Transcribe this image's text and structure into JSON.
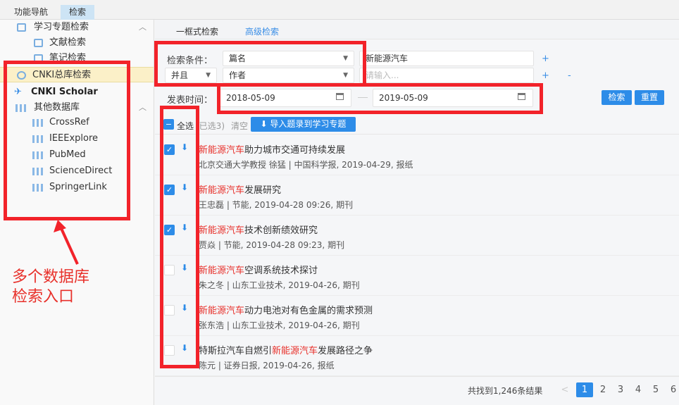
{
  "top_tabs": [
    "功能导航",
    "检索"
  ],
  "sidebar": {
    "topic_search": "学习专题检索",
    "doc_search": "文献检索",
    "note_search": "笔记检索",
    "cnki_total": "CNKI总库检索",
    "cnki_scholar": "CNKI Scholar",
    "other_db": "其他数据库",
    "databases": [
      "CrossRef",
      "IEEExplore",
      "PubMed",
      "ScienceDirect",
      "SpringerLink"
    ]
  },
  "search_tabs": [
    "一框式检索",
    "高级检索"
  ],
  "form": {
    "cond_label": "检索条件：",
    "field1": "篇名",
    "value1": "新能源汽车",
    "logic": "并且",
    "field2": "作者",
    "placeholder2": "请输入...",
    "date_label": "发表时间：",
    "date_from": "2018-05-09",
    "date_to": "2019-05-09",
    "search_btn": "检索",
    "reset_btn": "重置",
    "plus": "+",
    "minus": "-"
  },
  "toolbar": {
    "select_all": "全选",
    "selected": "(已选3)",
    "clear": "清空",
    "import_btn": "导入题录到学习专题"
  },
  "results": [
    {
      "pre": "",
      "hl": "新能源汽车",
      "post": "助力城市交通可持续发展",
      "meta": "北京交通大学教授 徐猛 | 中国科学报, 2019-04-29, 报纸",
      "checked": true
    },
    {
      "pre": "",
      "hl": "新能源汽车",
      "post": "发展研究",
      "meta": "王忠磊 | 节能, 2019-04-28 09:26, 期刊",
      "checked": true
    },
    {
      "pre": "",
      "hl": "新能源汽车",
      "post": "技术创新绩效研究",
      "meta": "贾焱 | 节能, 2019-04-28 09:23, 期刊",
      "checked": true
    },
    {
      "pre": "",
      "hl": "新能源汽车",
      "post": "空调系统技术探讨",
      "meta": "朱之冬 | 山东工业技术, 2019-04-26, 期刊",
      "checked": false
    },
    {
      "pre": "",
      "hl": "新能源汽车",
      "post": "动力电池对有色金属的需求预测",
      "meta": "张东浩 | 山东工业技术, 2019-04-26, 期刊",
      "checked": false
    },
    {
      "pre": "特斯拉汽车自燃引",
      "hl": "新能源汽车",
      "post": "发展路径之争",
      "meta": "陈元 | 证券日报, 2019-04-26, 报纸",
      "checked": false
    }
  ],
  "pagination": {
    "total": "共找到1,246条结果",
    "prev": "<",
    "pages": [
      "1",
      "2",
      "3",
      "4",
      "5",
      "6"
    ]
  },
  "annotation": {
    "line1": "多个数据库",
    "line2": "检索入口"
  }
}
